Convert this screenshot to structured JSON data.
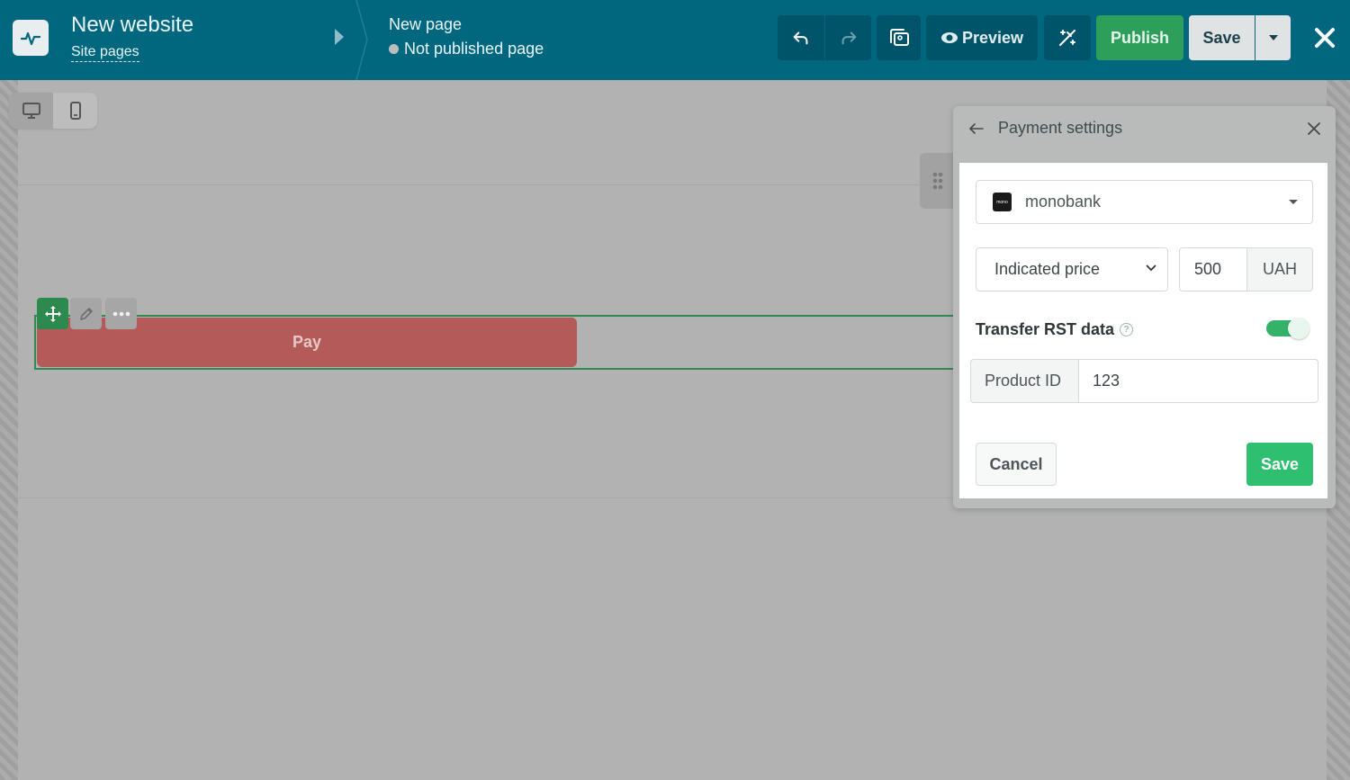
{
  "header": {
    "site_title": "New website",
    "site_pages_link": "Site pages",
    "page_title": "New page",
    "page_status": "Not published page",
    "preview_label": "Preview",
    "publish_label": "Publish",
    "save_label": "Save"
  },
  "canvas": {
    "pay_button_label": "Pay"
  },
  "payment_panel": {
    "title": "Payment settings",
    "provider": "monobank",
    "provider_logo_text": "mono",
    "price_mode": "Indicated price",
    "price_value": "500",
    "currency": "UAH",
    "transfer_label": "Transfer RST data",
    "transfer_enabled": true,
    "product_id_label": "Product ID",
    "product_id_value": "123",
    "cancel_label": "Cancel",
    "save_label": "Save"
  },
  "colors": {
    "topbar": "#00677f",
    "publish": "#2e9e5b",
    "save_green": "#2fbf71",
    "pay_button": "#b45a58"
  },
  "icons": [
    "pulse-logo-icon",
    "undo-icon",
    "redo-icon",
    "media-icon",
    "eye-icon",
    "magic-icon",
    "caret-down-icon",
    "close-icon",
    "desktop-icon",
    "mobile-icon",
    "drag-grip-icon",
    "move-icon",
    "pencil-icon",
    "more-icon",
    "back-arrow-icon",
    "help-icon",
    "chevron-down-icon"
  ]
}
